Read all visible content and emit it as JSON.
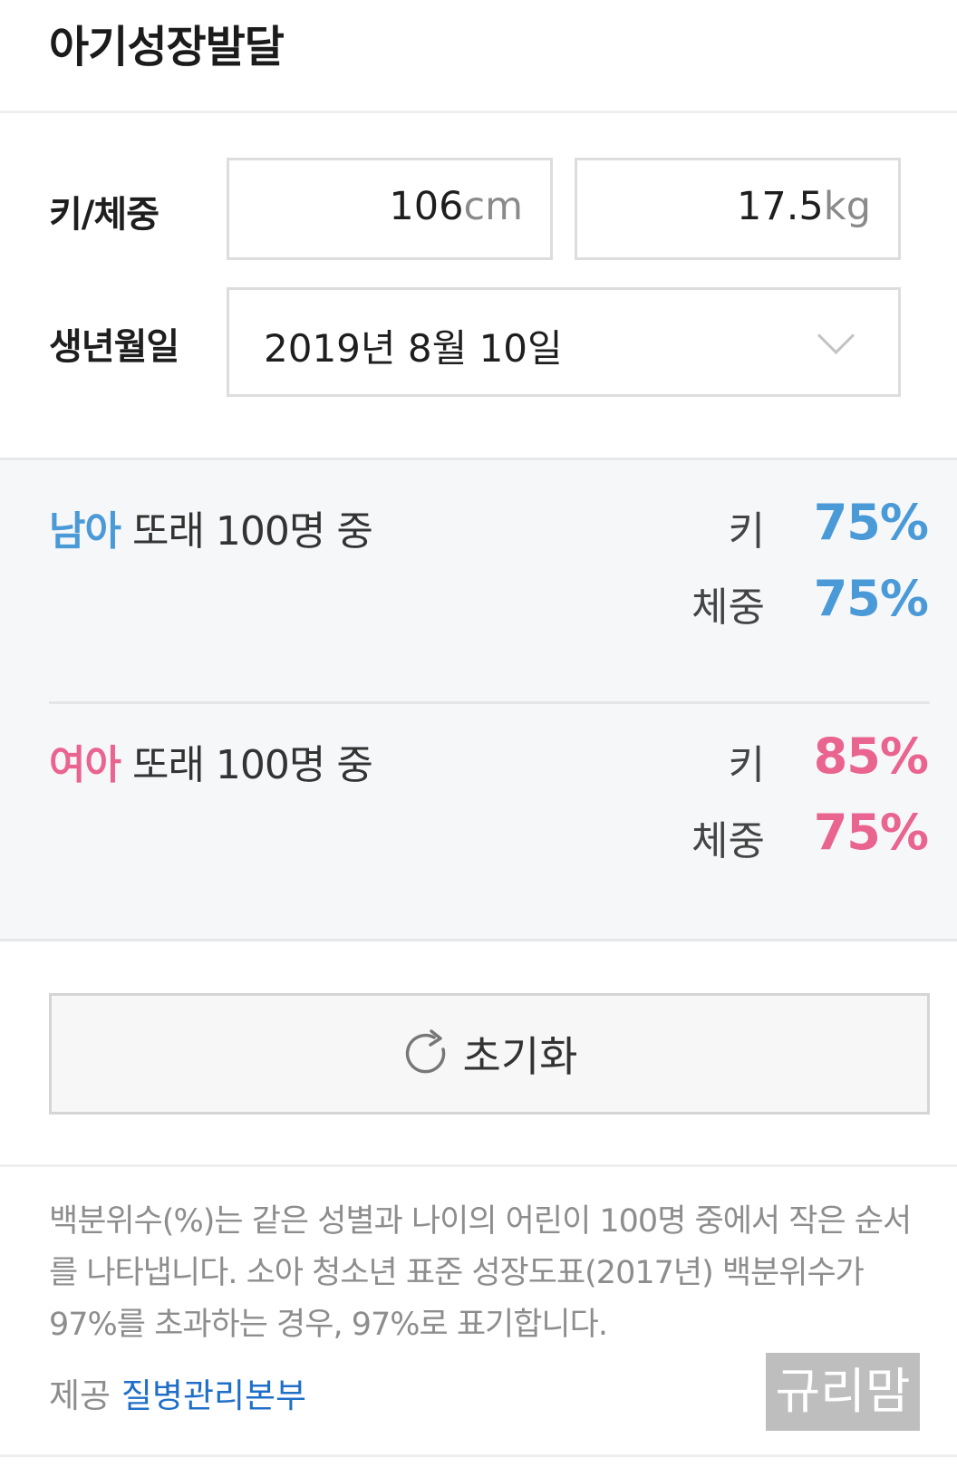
{
  "app": {
    "title": "아기성장발달"
  },
  "inputs": {
    "height_weight_label": "키/체중",
    "height": {
      "value": "106",
      "unit": "cm"
    },
    "weight": {
      "value": "17.5",
      "unit": "kg"
    },
    "birthdate_label": "생년월일",
    "birthdate_value": "2019년 8월 10일"
  },
  "results": {
    "boy": {
      "sex": "남아",
      "suffix": "또래 100명 중",
      "height_label": "키",
      "height_percentile": "75%",
      "weight_label": "체중",
      "weight_percentile": "75%"
    },
    "girl": {
      "sex": "여아",
      "suffix": "또래 100명 중",
      "height_label": "키",
      "height_percentile": "85%",
      "weight_label": "체중",
      "weight_percentile": "75%"
    }
  },
  "actions": {
    "reset_label": "초기화"
  },
  "footer": {
    "notice": "백분위수(%)는 같은 성별과 나이의 어린이 100명 중에서 작은 순서를 나타냅니다. 소아 청소년 표준 성장도표(2017년) 백분위수가 97%를 초과하는 경우, 97%로 표기합니다.",
    "provider_label": "제공",
    "provider_name": "질병관리본부"
  },
  "watermark": {
    "text": "규리맘"
  },
  "colors": {
    "boy": "#4b9ad8",
    "girl": "#e9648f",
    "link": "#1f6fc8"
  },
  "icons": {
    "dropdown": "chevron-down-icon",
    "reset": "refresh-icon"
  }
}
